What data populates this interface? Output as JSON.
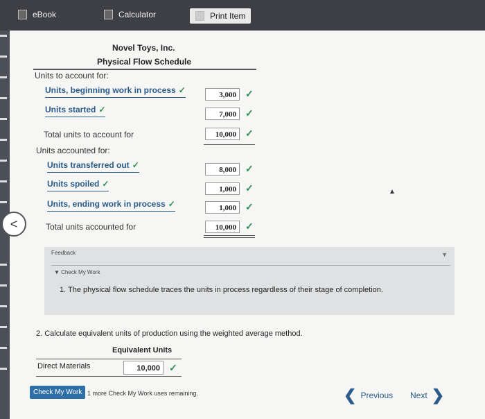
{
  "tabs": [
    {
      "label": "eBook"
    },
    {
      "label": "Calculator"
    },
    {
      "label": "Print Item"
    }
  ],
  "schedule": {
    "company": "Novel Toys, Inc.",
    "title": "Physical Flow Schedule",
    "to_account_header": "Units to account for:",
    "rows_to_account": [
      {
        "label": "Units, beginning work in process",
        "value": "3,000"
      },
      {
        "label": "Units started",
        "value": "7,000"
      }
    ],
    "total_to_account_label": "Total units to account for",
    "total_to_account_value": "10,000",
    "accounted_header": "Units accounted for:",
    "rows_accounted": [
      {
        "label": "Units transferred out",
        "value": "8,000"
      },
      {
        "label": "Units spoiled",
        "value": "1,000"
      },
      {
        "label": "Units, ending work in process",
        "value": "1,000"
      }
    ],
    "total_accounted_label": "Total units accounted for",
    "total_accounted_value": "10,000"
  },
  "feedback": {
    "title": "Feedback",
    "check_label": "Check My Work",
    "text": "1. The physical flow schedule traces the units in process regardless of their stage of completion."
  },
  "question2": {
    "text": "2. Calculate equivalent units of production using the weighted average method.",
    "column_header": "Equivalent Units",
    "row_label": "Direct Materials",
    "row_value": "10,000"
  },
  "footer": {
    "check_button": "Check My Work",
    "remaining": "1 more Check My Work uses remaining.",
    "previous": "Previous",
    "next": "Next"
  },
  "colors": {
    "accent": "#2a5b8a",
    "check": "#2e8b57",
    "topbar": "#3d3f44"
  }
}
